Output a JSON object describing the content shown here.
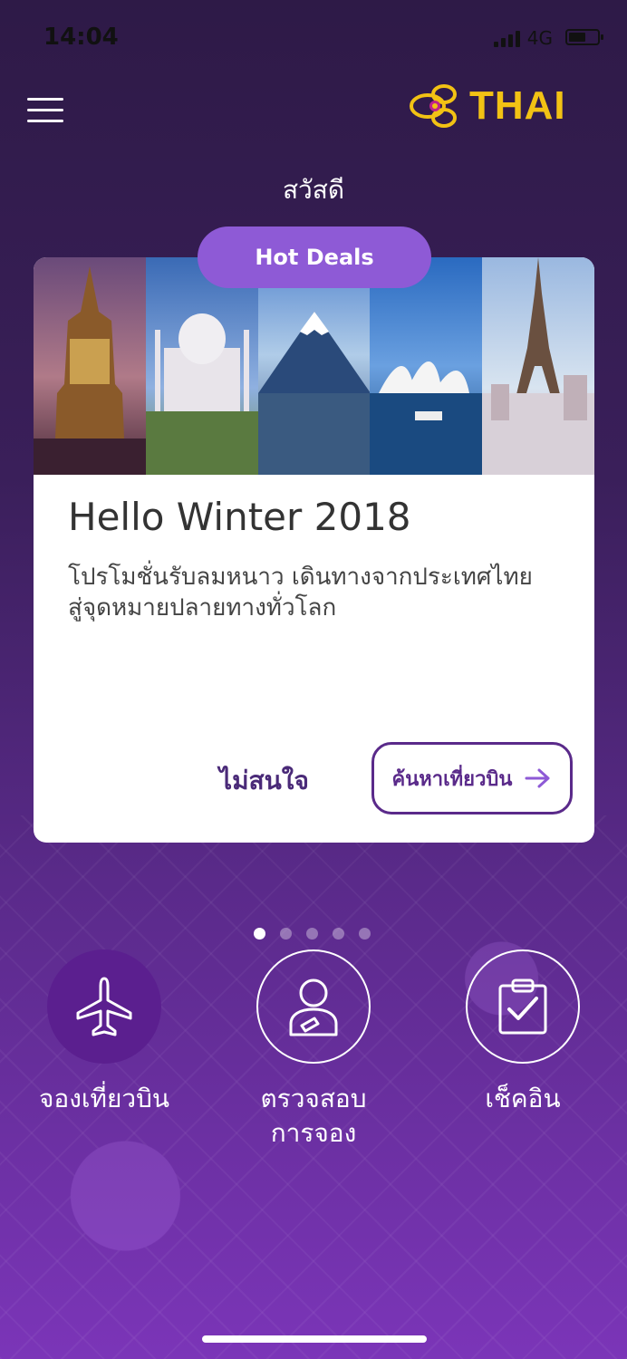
{
  "status_bar": {
    "time": "14:04",
    "network": "4G"
  },
  "header": {
    "menu_icon": "hamburger-menu-icon",
    "logo_text": "THAI",
    "logo_color": "#f2c214"
  },
  "greeting": "สวัสดี",
  "promo": {
    "badge": "Hot Deals",
    "title": "Hello Winter 2018",
    "description_line1": "โปรโมชั่นรับลมหนาว เดินทางจากประเทศไทย",
    "description_line2": "สู่จุดหมายปลายทางทั่วโลก",
    "dismiss_label": "ไม่สนใจ",
    "search_label": "ค้นหาเที่ยวบิน"
  },
  "carousel": {
    "count": 5,
    "active_index": 0
  },
  "actions": [
    {
      "label": "จองเที่ยวบิน",
      "icon": "airplane-icon"
    },
    {
      "label_line1": "ตรวจสอบ",
      "label_line2": "การจอง",
      "icon": "user-booking-icon"
    },
    {
      "label": "เช็คอิน",
      "icon": "clipboard-check-icon"
    }
  ],
  "colors": {
    "accent": "#5a2a8a",
    "badge": "#8e5ad6",
    "background": "#3a1f5a"
  }
}
